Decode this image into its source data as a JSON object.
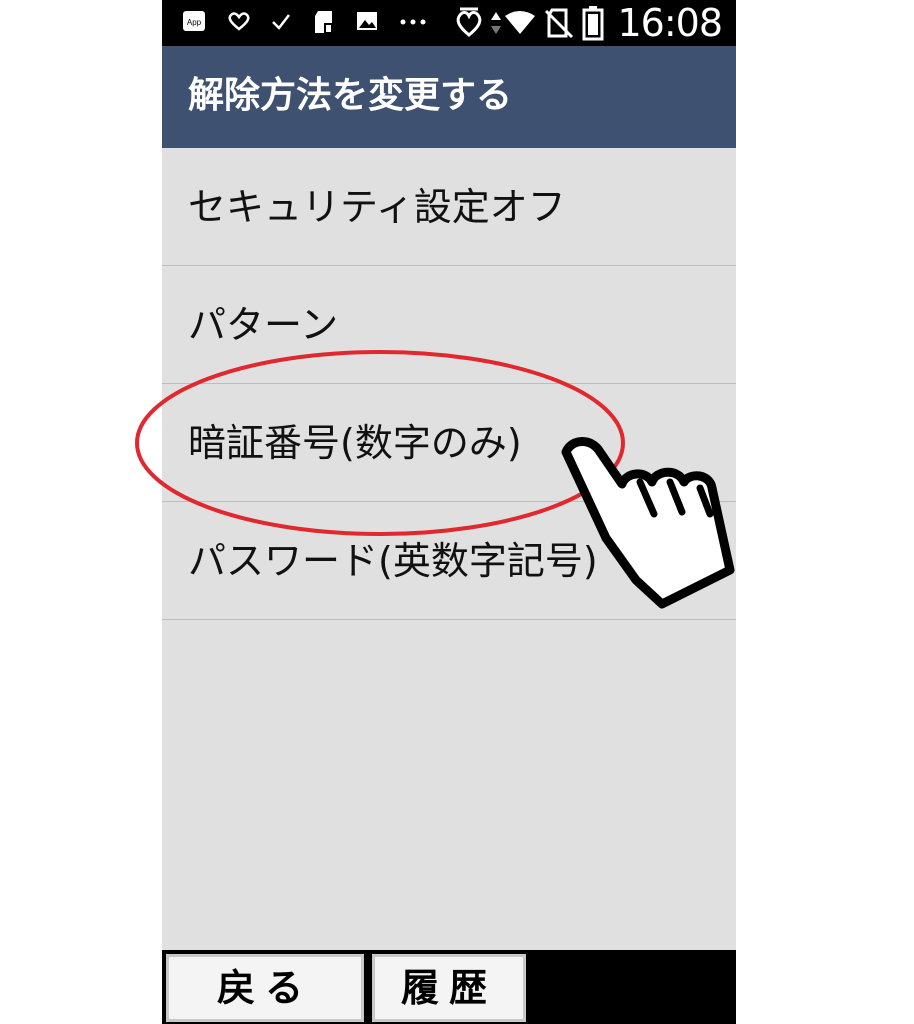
{
  "status_bar": {
    "time": "16:08",
    "app_badge": "App",
    "left_icons": [
      "app-icon",
      "heart-icon",
      "check-icon",
      "sd-card-icon",
      "image-icon",
      "more-icon"
    ],
    "right_icons": [
      "heart-outline-icon",
      "data-arrows-icon",
      "wifi-icon",
      "no-sim-icon",
      "battery-icon"
    ]
  },
  "header": {
    "title": "解除方法を変更する"
  },
  "menu": {
    "items": [
      {
        "label": "セキュリティ設定オフ"
      },
      {
        "label": "パターン"
      },
      {
        "label": "暗証番号(数字のみ)"
      },
      {
        "label": "パスワード(英数字記号)"
      }
    ]
  },
  "softkeys": {
    "back": "戻る",
    "history": "履歴"
  },
  "annotation": {
    "highlight_color": "#e0282e",
    "highlighted_item": "暗証番号(数字のみ)",
    "pointer": "hand-pointer-icon"
  }
}
